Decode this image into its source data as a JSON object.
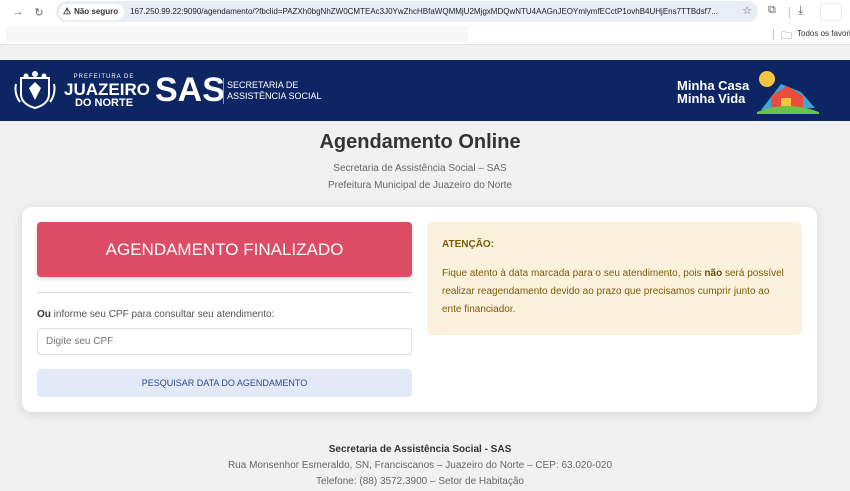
{
  "browser": {
    "security_label": "Não seguro",
    "url": "167.250.99.22:9090/agendamento/?fbclid=PAZXh0bgNhZW0CMTEAc3J0YwZhcHBfaWQMMjU2MjgxMDQwNTU4AAGnJEOYmlymfECctP1ovhB4UHjEns7TTBdsf7...",
    "bookmarks_label": "Todos os favoritos"
  },
  "header": {
    "prefeitura": "PREFEITURA DE",
    "juazeiro": "JUAZEIRO",
    "do_norte": "DO NORTE",
    "sas": "SAS",
    "secretaria_line1": "SECRETARIA DE",
    "secretaria_line2": "ASSISTÊNCIA SOCIAL",
    "mcmv_line1": "Minha Casa",
    "mcmv_line2": "Minha Vida"
  },
  "page": {
    "title": "Agendamento Online",
    "subtitle1": "Secretaria de Assistência Social – SAS",
    "subtitle2": "Prefeitura Municipal de Juazeiro do Norte"
  },
  "form": {
    "status_button": "AGENDAMENTO FINALIZADO",
    "cpf_label_bold": "Ou",
    "cpf_label_rest": " informe seu CPF para consultar seu atendimento:",
    "cpf_placeholder": "Digite seu CPF",
    "search_button": "PESQUISAR DATA DO AGENDAMENTO"
  },
  "alert": {
    "title": "ATENÇÃO:",
    "text_before": "Fique atento à data marcada para o seu atendimento, pois ",
    "text_bold": "não",
    "text_after": " será possível realizar reagendamento devido ao prazo que precisamos cumprir junto ao ente financiador."
  },
  "footer": {
    "line1": "Secretaria de Assistência Social - SAS",
    "line2": "Rua Monsenhor Esmeraldo, SN, Franciscanos – Juazeiro do Norte – CEP: 63.020-020",
    "line3": "Telefone: (88) 3572.3900 – Setor de Habitação"
  },
  "colors": {
    "header_bg": "#0d2562",
    "status_button": "#dc4c64",
    "alert_bg": "#fcf1dc",
    "search_button_bg": "#e3e9f7"
  }
}
